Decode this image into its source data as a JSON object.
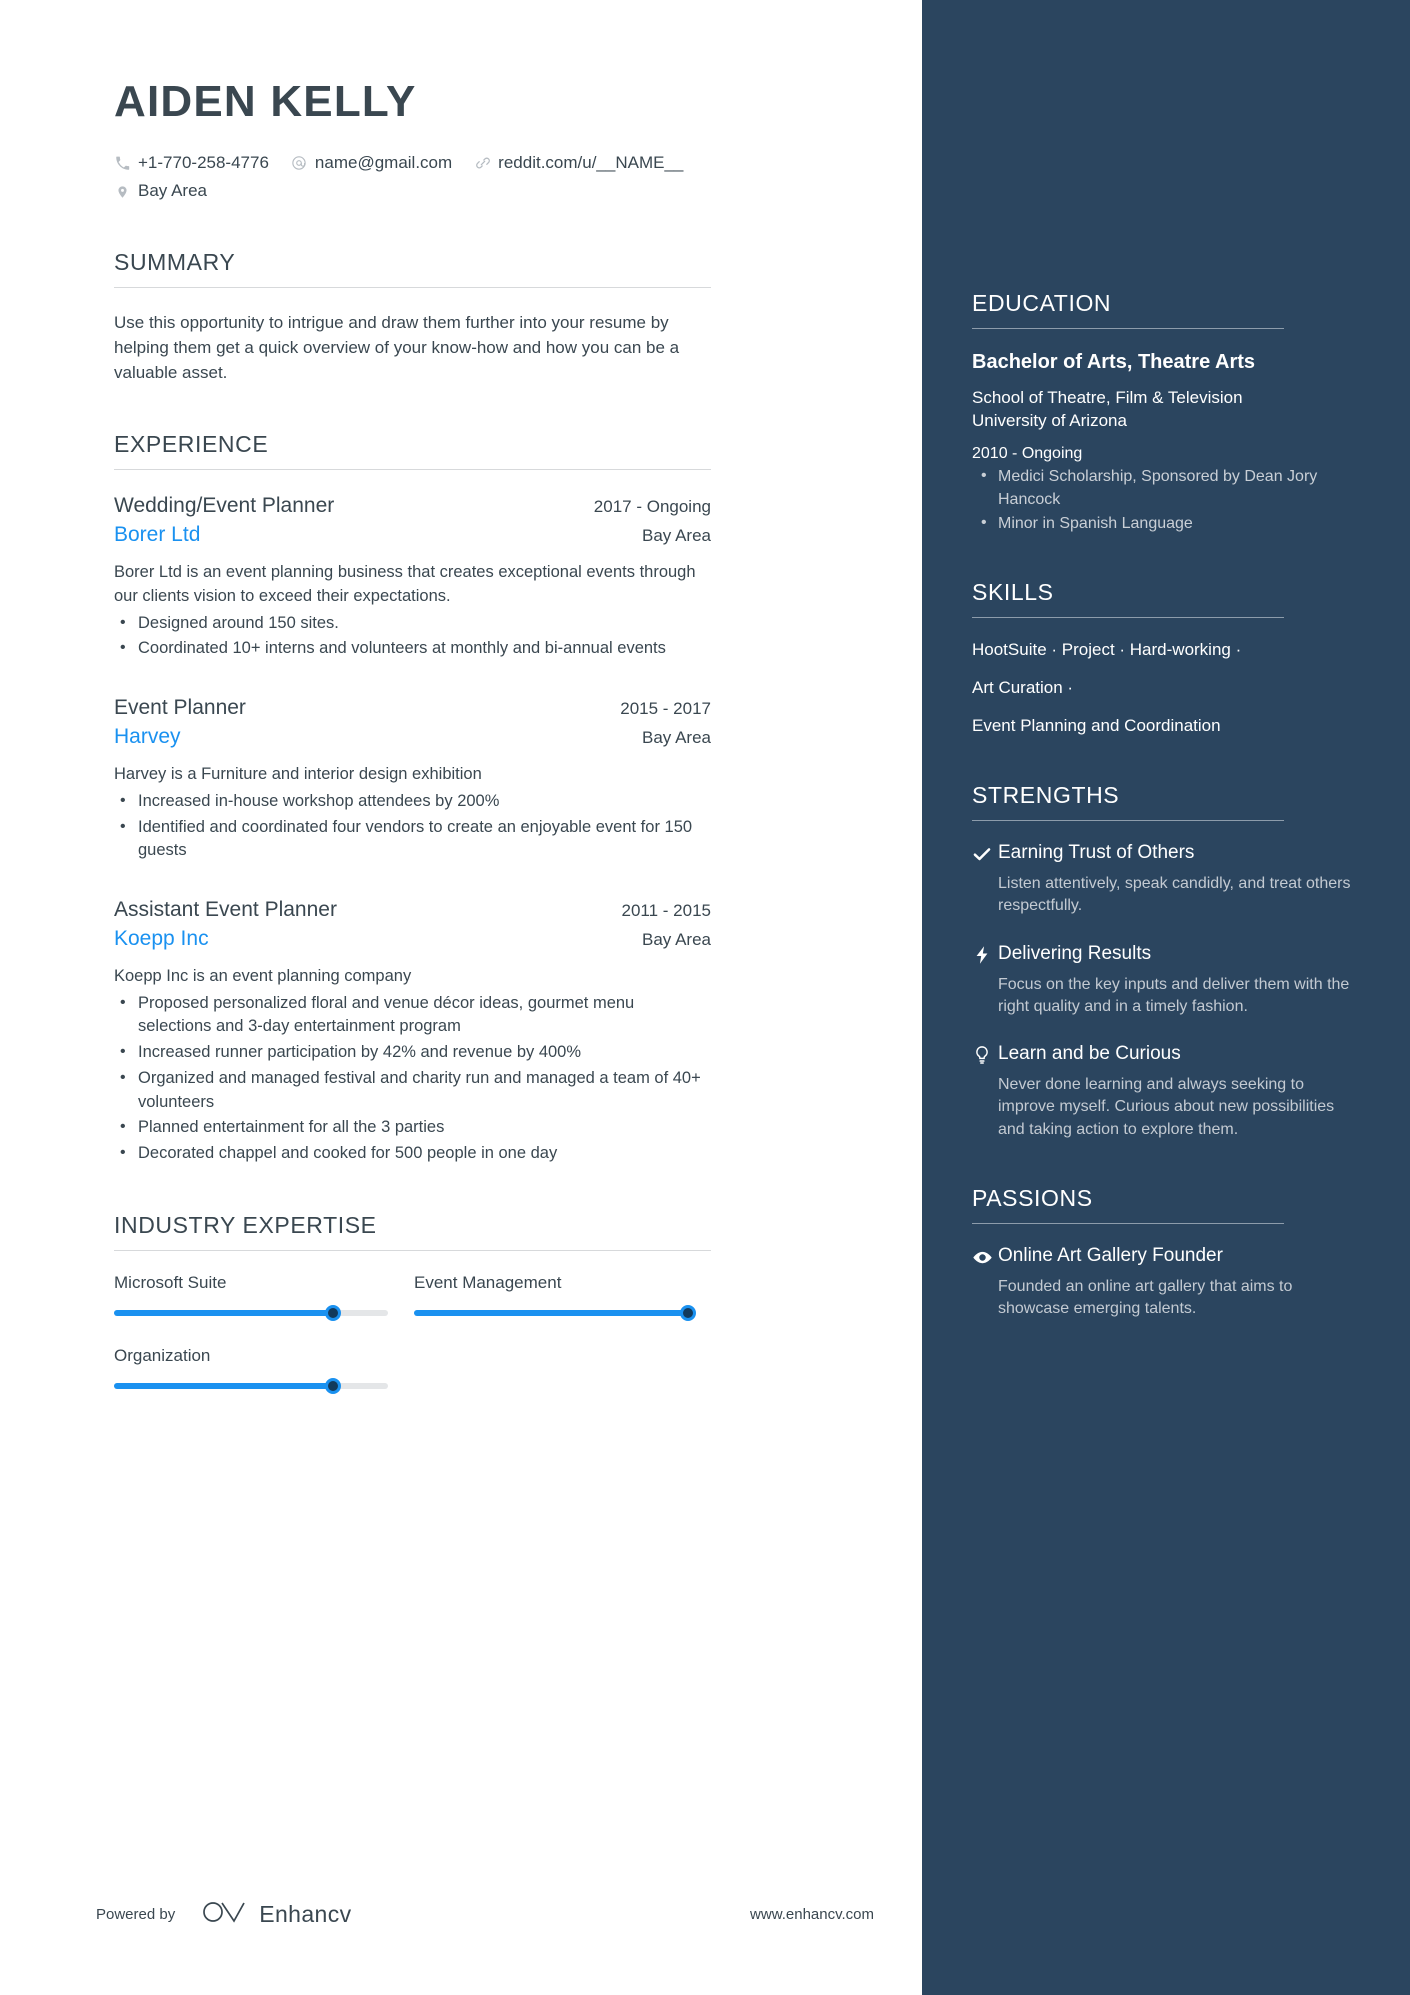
{
  "theme": {
    "sidebar_bg": "#2b455f",
    "accent_blue": "#1a91f0",
    "text_dark": "#3a4750",
    "page_bg": "#ffffff"
  },
  "header": {
    "name": "AIDEN KELLY",
    "contacts": [
      {
        "icon": "phone-icon",
        "text": "+1-770-258-4776"
      },
      {
        "icon": "email-icon",
        "text": "name@gmail.com"
      },
      {
        "icon": "link-icon",
        "text": "reddit.com/u/__NAME__"
      },
      {
        "icon": "location-pin-icon",
        "text": "Bay Area"
      }
    ]
  },
  "summary": {
    "title": "SUMMARY",
    "text": "Use this opportunity to intrigue and draw them further into your resume by helping them get a quick overview of your know-how and how you can be a valuable asset."
  },
  "experience": {
    "title": "EXPERIENCE",
    "jobs": [
      {
        "title": "Wedding/Event Planner",
        "date": "2017 - Ongoing",
        "company": "Borer Ltd",
        "location": "Bay Area",
        "description": "Borer Ltd is an event planning business that creates exceptional events through our clients vision to exceed their expectations.",
        "bullets": [
          "Designed around 150 sites.",
          "Coordinated 10+ interns and volunteers at monthly and bi-annual events"
        ]
      },
      {
        "title": "Event Planner",
        "date": "2015 - 2017",
        "company": "Harvey",
        "location": "Bay Area",
        "description": "Harvey is a Furniture and interior design exhibition",
        "bullets": [
          "Increased in-house workshop attendees by 200%",
          "Identified and coordinated four vendors to create an enjoyable event for 150 guests"
        ]
      },
      {
        "title": "Assistant Event Planner",
        "date": "2011 - 2015",
        "company": "Koepp Inc",
        "location": "Bay Area",
        "description": "Koepp Inc is an event planning company",
        "bullets": [
          "Proposed personalized floral and venue décor ideas, gourmet menu selections and 3-day entertainment program",
          "Increased runner participation by 42% and revenue by 400%",
          "Organized and managed festival and charity run and managed a team of 40+ volunteers",
          "Planned entertainment for all the 3 parties",
          "Decorated chappel and cooked for 500 people in one day"
        ]
      }
    ]
  },
  "industry_expertise": {
    "title": "INDUSTRY EXPERTISE",
    "items": [
      {
        "label": "Microsoft Suite",
        "percent": 80
      },
      {
        "label": "Event Management",
        "percent": 100
      },
      {
        "label": "Organization",
        "percent": 80
      }
    ]
  },
  "education": {
    "title": "EDUCATION",
    "degree": "Bachelor of Arts, Theatre Arts",
    "school": "School of Theatre, Film & Television\nUniversity of Arizona",
    "date": "2010 - Ongoing",
    "bullets": [
      "Medici Scholarship, Sponsored by Dean Jory Hancock",
      "Minor in Spanish Language"
    ]
  },
  "skills": {
    "title": "SKILLS",
    "lines": [
      "HootSuite · Project · Hard-working ·",
      "Art Curation ·",
      "Event Planning and Coordination"
    ]
  },
  "strengths": {
    "title": "STRENGTHS",
    "items": [
      {
        "icon": "check-icon",
        "title": "Earning Trust of Others",
        "description": "Listen attentively, speak candidly, and treat others respectfully."
      },
      {
        "icon": "lightning-bolt-icon",
        "title": "Delivering Results",
        "description": "Focus on the key inputs and deliver them with the right quality and in a timely fashion."
      },
      {
        "icon": "lightbulb-icon",
        "title": "Learn and be Curious",
        "description": "Never done learning and always seeking to improve myself. Curious about new possibilities and taking action to explore them."
      }
    ]
  },
  "passions": {
    "title": "PASSIONS",
    "items": [
      {
        "icon": "eye-icon",
        "title": "Online Art Gallery Founder",
        "description": "Founded an online art gallery that aims to\nshowcase emerging talents."
      }
    ]
  },
  "footer": {
    "powered_by": "Powered by",
    "brand": "Enhancv",
    "url": "www.enhancv.com"
  }
}
